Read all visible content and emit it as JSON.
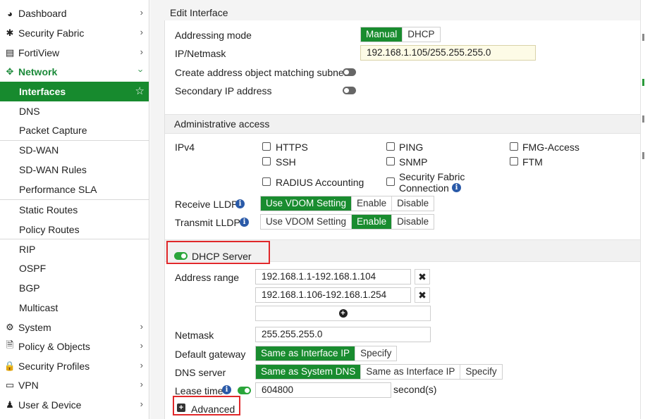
{
  "sidebar": {
    "items": [
      {
        "label": "Dashboard"
      },
      {
        "label": "Security Fabric"
      },
      {
        "label": "FortiView"
      },
      {
        "label": "Network"
      },
      {
        "label": "Interfaces"
      },
      {
        "label": "DNS"
      },
      {
        "label": "Packet Capture"
      },
      {
        "label": "SD-WAN"
      },
      {
        "label": "SD-WAN Rules"
      },
      {
        "label": "Performance SLA"
      },
      {
        "label": "Static Routes"
      },
      {
        "label": "Policy Routes"
      },
      {
        "label": "RIP"
      },
      {
        "label": "OSPF"
      },
      {
        "label": "BGP"
      },
      {
        "label": "Multicast"
      },
      {
        "label": "System"
      },
      {
        "label": "Policy & Objects"
      },
      {
        "label": "Security Profiles"
      },
      {
        "label": "VPN"
      },
      {
        "label": "User & Device"
      }
    ]
  },
  "page": {
    "title": "Edit Interface"
  },
  "addressing": {
    "mode_label": "Addressing mode",
    "mode_options": [
      "Manual",
      "DHCP"
    ],
    "ip_label": "IP/Netmask",
    "ip_value": "192.168.1.105/255.255.255.0",
    "create_obj_label": "Create address object matching subnet",
    "secondary_label": "Secondary IP address"
  },
  "admin": {
    "section_title": "Administrative access",
    "ipv4_label": "IPv4",
    "options": {
      "https": "HTTPS",
      "ping": "PING",
      "fmg": "FMG-Access",
      "ssh": "SSH",
      "snmp": "SNMP",
      "ftm": "FTM",
      "radius": "RADIUS Accounting",
      "fabric_line1": "Security Fabric",
      "fabric_line2": "Connection"
    },
    "receive_lldp_label": "Receive LLDP",
    "transmit_lldp_label": "Transmit LLDP",
    "lldp_options": [
      "Use VDOM Setting",
      "Enable",
      "Disable"
    ]
  },
  "dhcp": {
    "title": "DHCP Server",
    "range_label": "Address range",
    "ranges": [
      "192.168.1.1-192.168.1.104",
      "192.168.1.106-192.168.1.254"
    ],
    "netmask_label": "Netmask",
    "netmask_value": "255.255.255.0",
    "gateway_label": "Default gateway",
    "gateway_options": [
      "Same as Interface IP",
      "Specify"
    ],
    "dns_label": "DNS server",
    "dns_options": [
      "Same as System DNS",
      "Same as Interface IP",
      "Specify"
    ],
    "lease_label": "Lease time",
    "lease_value": "604800",
    "lease_unit": "second(s)",
    "advanced_label": "Advanced"
  },
  "colors": {
    "accent": "#198c2f",
    "highlight": "#e0282a",
    "info": "#2a5aa8"
  }
}
